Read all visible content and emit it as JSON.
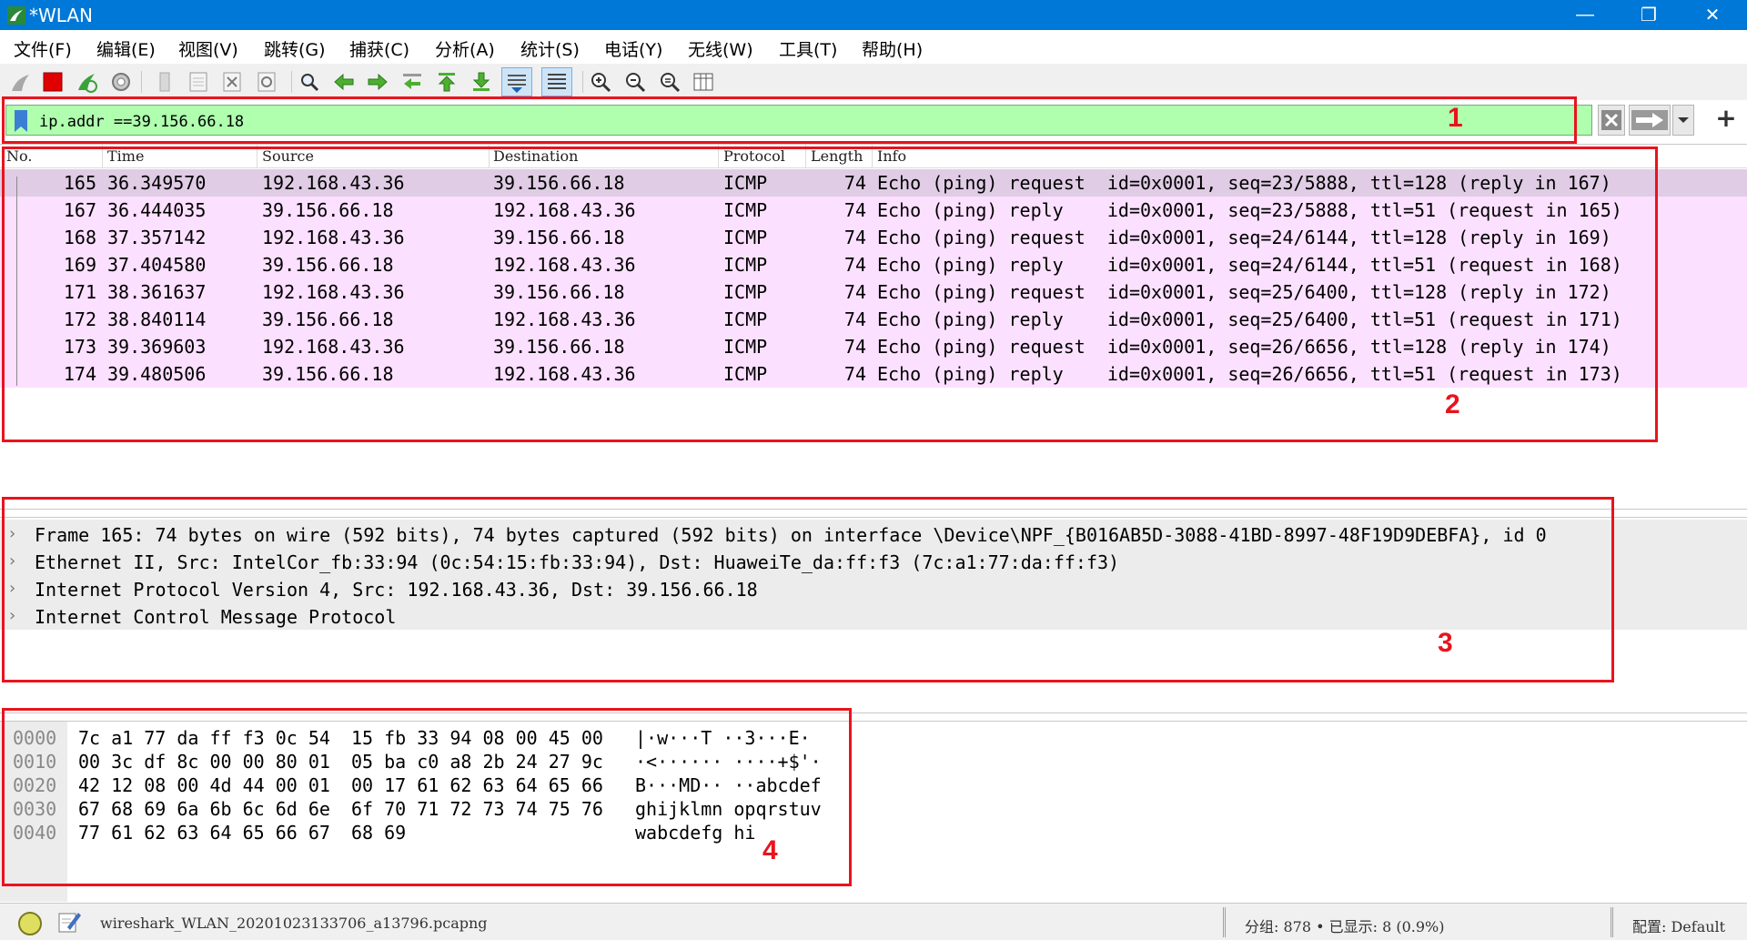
{
  "window": {
    "title": "*WLAN",
    "minimize_glyph": "—",
    "restore_glyph": "❐",
    "close_glyph": "✕"
  },
  "menu": [
    "文件(F)",
    "编辑(E)",
    "视图(V)",
    "跳转(G)",
    "捕获(C)",
    "分析(A)",
    "统计(S)",
    "电话(Y)",
    "无线(W)",
    "工具(T)",
    "帮助(H)"
  ],
  "toolbar": {
    "icons": [
      "shark-fin-start-icon",
      "stop-capture-icon",
      "restart-capture-icon",
      "capture-options-icon",
      "open-file-icon",
      "save-file-icon",
      "close-file-icon",
      "reload-file-icon",
      "find-packet-icon",
      "go-back-icon",
      "go-forward-icon",
      "go-to-packet-icon",
      "go-first-packet-icon",
      "go-last-packet-icon",
      "auto-scroll-icon",
      "colorize-icon",
      "zoom-in-icon",
      "zoom-out-icon",
      "zoom-normal-icon",
      "resize-columns-icon"
    ]
  },
  "filter": {
    "value": "ip.addr ==39.156.66.18",
    "add_button_glyph": "+"
  },
  "packet_list": {
    "columns": [
      "No.",
      "Time",
      "Source",
      "Destination",
      "Protocol",
      "Length",
      "Info"
    ],
    "rows": [
      {
        "no": "165",
        "time": "36.349570",
        "src": "192.168.43.36",
        "dst": "39.156.66.18",
        "proto": "ICMP",
        "len": "74",
        "info": "Echo (ping) request  id=0x0001, seq=23/5888, ttl=128 (reply in 167)"
      },
      {
        "no": "167",
        "time": "36.444035",
        "src": "39.156.66.18",
        "dst": "192.168.43.36",
        "proto": "ICMP",
        "len": "74",
        "info": "Echo (ping) reply    id=0x0001, seq=23/5888, ttl=51 (request in 165)"
      },
      {
        "no": "168",
        "time": "37.357142",
        "src": "192.168.43.36",
        "dst": "39.156.66.18",
        "proto": "ICMP",
        "len": "74",
        "info": "Echo (ping) request  id=0x0001, seq=24/6144, ttl=128 (reply in 169)"
      },
      {
        "no": "169",
        "time": "37.404580",
        "src": "39.156.66.18",
        "dst": "192.168.43.36",
        "proto": "ICMP",
        "len": "74",
        "info": "Echo (ping) reply    id=0x0001, seq=24/6144, ttl=51 (request in 168)"
      },
      {
        "no": "171",
        "time": "38.361637",
        "src": "192.168.43.36",
        "dst": "39.156.66.18",
        "proto": "ICMP",
        "len": "74",
        "info": "Echo (ping) request  id=0x0001, seq=25/6400, ttl=128 (reply in 172)"
      },
      {
        "no": "172",
        "time": "38.840114",
        "src": "39.156.66.18",
        "dst": "192.168.43.36",
        "proto": "ICMP",
        "len": "74",
        "info": "Echo (ping) reply    id=0x0001, seq=25/6400, ttl=51 (request in 171)"
      },
      {
        "no": "173",
        "time": "39.369603",
        "src": "192.168.43.36",
        "dst": "39.156.66.18",
        "proto": "ICMP",
        "len": "74",
        "info": "Echo (ping) request  id=0x0001, seq=26/6656, ttl=128 (reply in 174)"
      },
      {
        "no": "174",
        "time": "39.480506",
        "src": "39.156.66.18",
        "dst": "192.168.43.36",
        "proto": "ICMP",
        "len": "74",
        "info": "Echo (ping) reply    id=0x0001, seq=26/6656, ttl=51 (request in 173)"
      }
    ]
  },
  "details": {
    "rows": [
      "Frame 165: 74 bytes on wire (592 bits), 74 bytes captured (592 bits) on interface \\Device\\NPF_{B016AB5D-3088-41BD-8997-48F19D9DEBFA}, id 0",
      "Ethernet II, Src: IntelCor_fb:33:94 (0c:54:15:fb:33:94), Dst: HuaweiTe_da:ff:f3 (7c:a1:77:da:ff:f3)",
      "Internet Protocol Version 4, Src: 192.168.43.36, Dst: 39.156.66.18",
      "Internet Control Message Protocol"
    ],
    "expander_glyph": "›"
  },
  "bytes": {
    "lines": [
      {
        "offset": "0000",
        "hex1": "7c a1 77 da ff f3 0c 54",
        "hex2": "15 fb 33 94 08 00 45 00",
        "ascii": "|·w···T ··3···E·"
      },
      {
        "offset": "0010",
        "hex1": "00 3c df 8c 00 00 80 01",
        "hex2": "05 ba c0 a8 2b 24 27 9c",
        "ascii": "·<······ ····+$'·"
      },
      {
        "offset": "0020",
        "hex1": "42 12 08 00 4d 44 00 01",
        "hex2": "00 17 61 62 63 64 65 66",
        "ascii": "B···MD·· ··abcdef"
      },
      {
        "offset": "0030",
        "hex1": "67 68 69 6a 6b 6c 6d 6e",
        "hex2": "6f 70 71 72 73 74 75 76",
        "ascii": "ghijklmn opqrstuv"
      },
      {
        "offset": "0040",
        "hex1": "77 61 62 63 64 65 66 67",
        "hex2": "68 69",
        "ascii": "wabcdefg hi"
      }
    ]
  },
  "status": {
    "filename": "wireshark_WLAN_20201023133706_a13796.pcapng",
    "packets": "分组: 878 • 已显示: 8 (0.9%)",
    "profile": "配置: Default"
  },
  "annotations": [
    "1",
    "2",
    "3",
    "4"
  ],
  "colors": {
    "titlebar": "#0078d7",
    "filter_bg": "#afffaf",
    "row_bg": "#fce0ff",
    "row_selected": "#e0cce5",
    "annotation": "#e8141e"
  }
}
